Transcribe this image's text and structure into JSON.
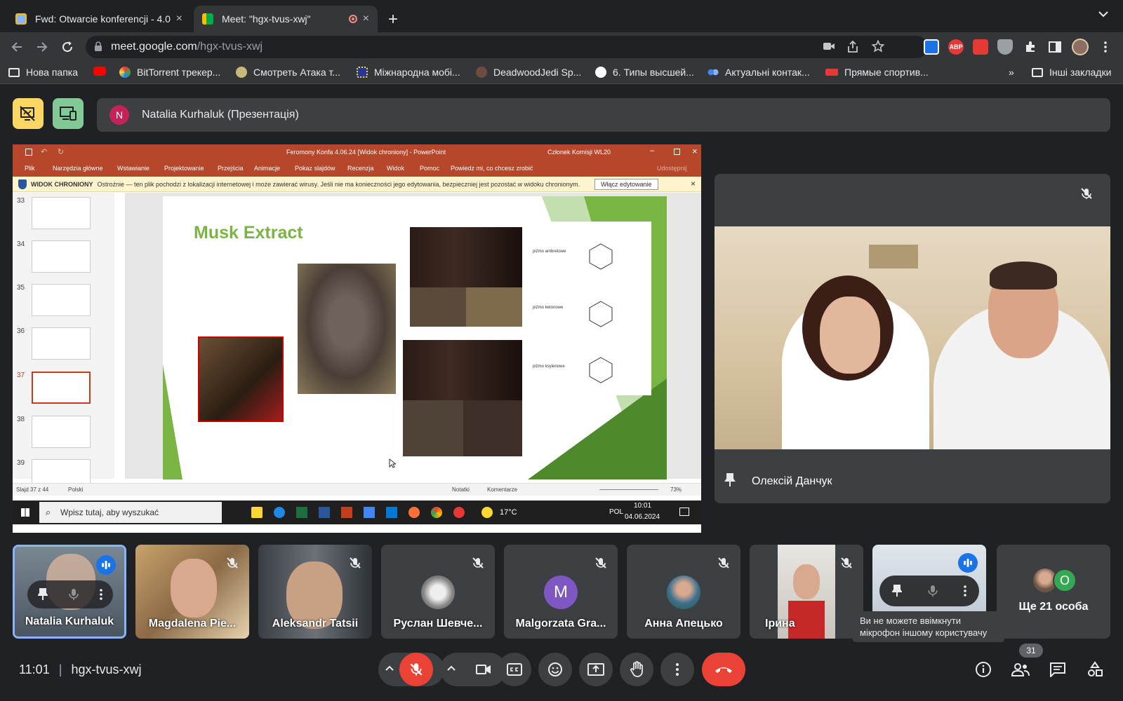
{
  "browser": {
    "tabs": [
      {
        "title": "Fwd: Otwarcie konferencji - 4.0",
        "close": "×"
      },
      {
        "title": "Meet: \"hgx-tvus-xwj\"",
        "close": "×"
      }
    ],
    "new_tab": "+",
    "url_domain": "meet.google.com",
    "url_path": "/hgx-tvus-xwj",
    "ext_abp": "ABP",
    "bookmarks": [
      "Нова папка",
      "",
      "BitTorrent трекер...",
      "Смотреть Атака т...",
      "Міжнародна мобі...",
      "DeadwoodJedi Sp...",
      "6. Типы высшей...",
      "Актуальні контак...",
      "Прямые спортив..."
    ],
    "bookmarks_more": "»",
    "other_bookmarks": "Інші закладки"
  },
  "meet": {
    "presenter_initial": "N",
    "presenter_label": "Natalia Kurhaluk (Презентація)",
    "speaker_name": "Олексій Данчук",
    "participants": [
      {
        "name": "Natalia Kurhaluk"
      },
      {
        "name": "Magdalena Pie..."
      },
      {
        "name": "Aleksandr Tatsii"
      },
      {
        "name": "Руслан Шевче..."
      },
      {
        "name": "Malgorzata Gra...",
        "initial": "M"
      },
      {
        "name": "Анна Апецько"
      },
      {
        "name": "Ірина"
      },
      {
        "name": ""
      }
    ],
    "more_people": "Ще 21 особа",
    "more_initial": "O",
    "tooltip": "Ви не можете ввімкнути мікрофон іншому користувачу",
    "time": "11:01",
    "divider": "|",
    "meeting_code": "hgx-tvus-xwj",
    "participants_count": "31"
  },
  "powerpoint": {
    "title": "Feromony Konfa 4.06.24 [Widok chroniony] - PowerPoint",
    "user": "Członek Komisji WL20",
    "menu": [
      "Plik",
      "Narzędzia główne",
      "Wstawianie",
      "Projektowanie",
      "Przejścia",
      "Animacje",
      "Pokaz slajdów",
      "Recenzja",
      "Widok",
      "Pomoc",
      "Powiedz mi, co chcesz zrobić"
    ],
    "share": "Udostępnij",
    "protected_label": "WIDOK CHRONIONY",
    "protected_text": "Ostrożnie — ten plik pochodzi z lokalizacji internetowej i może zawierać wirusy. Jeśli nie ma konieczności jego edytowania, bezpieczniej jest pozostać w widoku chronionym.",
    "enable_button": "Włącz edytowanie",
    "slide_numbers": [
      "33",
      "34",
      "35",
      "36",
      "37",
      "38",
      "39"
    ],
    "slide_title": "Musk Extract",
    "chem_labels": [
      "piżmo ambretowe",
      "piżmo ketonowe",
      "piżmo ksylenowe"
    ],
    "status_slide": "Slajd 37 z 44",
    "status_lang": "Polski",
    "notes": "Notatki",
    "comments": "Komentarze",
    "zoom": "73%",
    "win_search": "Wpisz tutaj, aby wyszukać",
    "weather": "17°C",
    "lang": "POL",
    "win_time": "10:01",
    "win_date": "04.06.2024"
  },
  "colors": {
    "accent_yellow": "#fdd663",
    "accent_green": "#81c995",
    "hangup_red": "#ea4335",
    "ppt_red": "#b7472a",
    "slide_green": "#7ab442"
  }
}
